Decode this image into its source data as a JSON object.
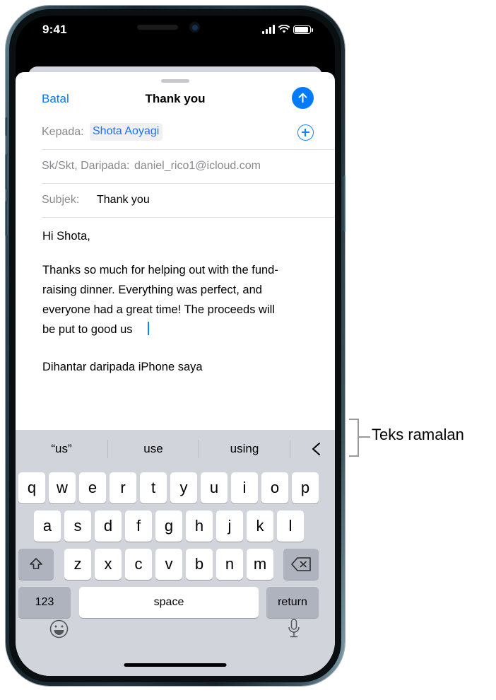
{
  "status_bar": {
    "time": "9:41",
    "signal_icon": "cellular-bars-icon",
    "wifi_icon": "wifi-icon",
    "battery_icon": "battery-full-icon"
  },
  "compose_sheet": {
    "cancel_label": "Batal",
    "title": "Thank you",
    "send_icon": "send-arrow-up-icon",
    "grabber": "sheet-grabber",
    "fields": {
      "to": {
        "label": "Kepada:",
        "value": "Shota Aoyagi",
        "add_icon": "add-recipient-plus-icon"
      },
      "cc_from": {
        "label": "Sk/Skt, Daripada:",
        "value": "daniel_rico1@icloud.com"
      },
      "subject": {
        "label": "Subjek:",
        "value": "Thank you"
      }
    },
    "body_lines": [
      "Hi Shota,",
      "",
      "Thanks so much for helping out with the fund-",
      "raising dinner. Everything was perfect, and",
      "everyone had a great time! The proceeds will",
      "be put to good us",
      "",
      "Dihantar daripada iPhone saya"
    ]
  },
  "keyboard": {
    "predictions": [
      "“us”",
      "use",
      "using"
    ],
    "collapse_icon": "chevron-left-icon",
    "row1": [
      "q",
      "w",
      "e",
      "r",
      "t",
      "y",
      "u",
      "i",
      "o",
      "p"
    ],
    "row2": [
      "a",
      "s",
      "d",
      "f",
      "g",
      "h",
      "j",
      "k",
      "l"
    ],
    "row3_letters": [
      "z",
      "x",
      "c",
      "v",
      "b",
      "n",
      "m"
    ],
    "shift_icon": "shift-arrow-up-icon",
    "delete_icon": "backspace-delete-icon",
    "numbers_label": "123",
    "space_label": "space",
    "return_label": "return",
    "emoji_icon": "emoji-smiley-icon",
    "dictation_icon": "microphone-icon"
  },
  "callout": {
    "label": "Teks ramalan"
  },
  "colors": {
    "accent_blue": "#007aff",
    "link_blue": "#1b6eff",
    "keyboard_bg": "#d1d5db",
    "key_white": "#ffffff",
    "key_gray": "#aeb3bd",
    "label_gray": "#8a8a8e"
  }
}
